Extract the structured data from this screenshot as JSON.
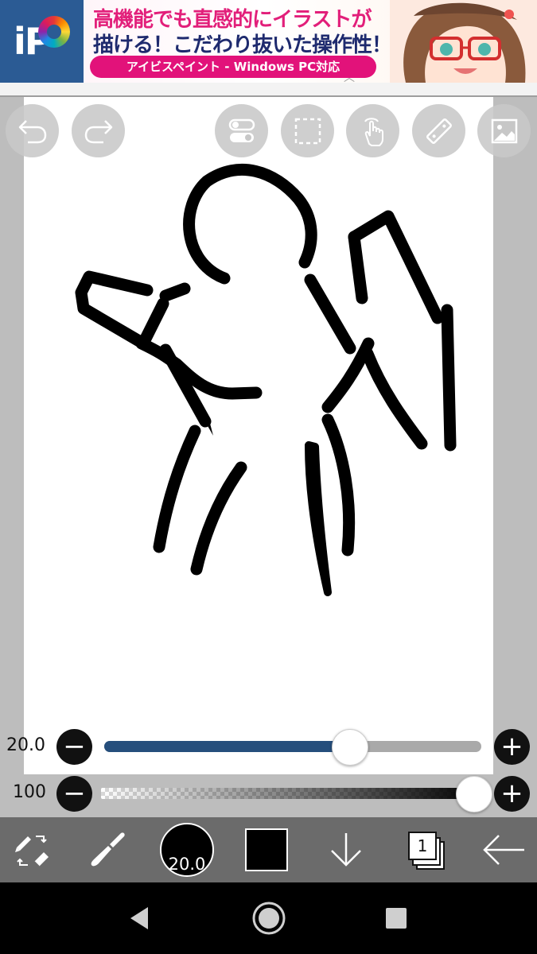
{
  "ad": {
    "logo_text": "iP",
    "headline_line1": "高機能でも直感的にイラストが",
    "headline_line2": "描ける！こだわり抜いた操作性！",
    "cta": "アイビスペイント - Windows PC対応"
  },
  "top_toolbar": {
    "buttons": [
      "undo-icon",
      "redo-icon",
      "toggle-icon",
      "selection-icon",
      "touch-icon",
      "ruler-icon",
      "reference-image-icon"
    ]
  },
  "sliders": {
    "brush_size": {
      "label": "20.0",
      "value": 20.0,
      "fill_fraction": 0.65,
      "minus": "−",
      "plus": "+"
    },
    "opacity": {
      "label": "100",
      "value": 100,
      "fill_fraction": 1.0,
      "minus": "−",
      "plus": "+"
    }
  },
  "bottom_toolbar": {
    "brush_size_label": "20.0",
    "color": "#000000",
    "layer_count": "1",
    "items": [
      "swap-tool-icon",
      "brush-icon",
      "brush-size",
      "color-swatch",
      "move-down-icon",
      "layers-icon",
      "back-arrow-icon"
    ]
  },
  "colors": {
    "accent": "#254e7c",
    "toolbar": "#6b6b6b",
    "background": "#bdbdbd",
    "canvas": "#ffffff"
  },
  "nav_bar": {
    "items": [
      "back-triangle-icon",
      "home-circle-icon",
      "recents-square-icon"
    ]
  }
}
